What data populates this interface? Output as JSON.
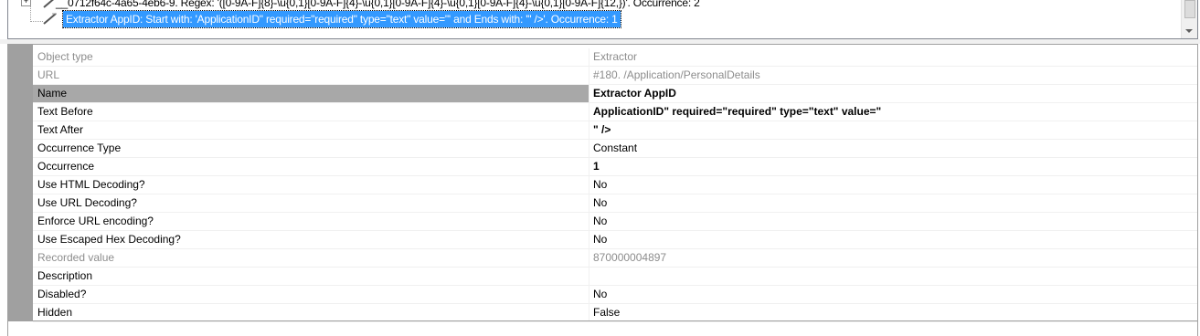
{
  "tree": {
    "items": [
      {
        "label": "__0712f64c-4a65-4eb6-9. Regex: '([0-9A-F]{8}-\\u{0,1}[0-9A-F]{4}-\\u{0,1}[0-9A-F]{4}-\\u{0,1}[0-9A-F]{4}-\\u{0,1}[0-9A-F]{12,})'. Occurrence: 2",
        "icon": "extractor-icon",
        "expander": "+"
      },
      {
        "label": "Extractor AppID: Start with: 'ApplicationID\" required=\"required\" type=\"text\" value=\"' and Ends with: '\" />'. Occurrence: 1",
        "icon": "extractor-icon",
        "selected": true
      }
    ]
  },
  "properties": [
    {
      "name": "Object type",
      "value": "Extractor",
      "readonly": true
    },
    {
      "name": "URL",
      "value": "#180. /Application/PersonalDetails",
      "readonly": true
    },
    {
      "name": "Name",
      "value": "Extractor AppID",
      "selected": true,
      "bold": true
    },
    {
      "name": "Text Before",
      "value": "ApplicationID\" required=\"required\" type=\"text\" value=\"",
      "bold": true
    },
    {
      "name": "Text After",
      "value": "\" />",
      "bold": true
    },
    {
      "name": "Occurrence Type",
      "value": "Constant"
    },
    {
      "name": "Occurrence",
      "value": "1",
      "bold": true
    },
    {
      "name": "Use HTML Decoding?",
      "value": "No"
    },
    {
      "name": "Use URL Decoding?",
      "value": "No"
    },
    {
      "name": "Enforce URL encoding?",
      "value": "No"
    },
    {
      "name": "Use Escaped Hex Decoding?",
      "value": "No"
    },
    {
      "name": "Recorded value",
      "value": "870000004897",
      "readonly": true
    },
    {
      "name": "Description",
      "value": ""
    },
    {
      "name": "Disabled?",
      "value": "No"
    },
    {
      "name": "Hidden",
      "value": "False"
    }
  ],
  "colors": {
    "selection": "#3399ff",
    "grid_margin": "#a0a0a0",
    "selected_row": "#a8a8a8",
    "readonly_text": "#8d8d8d"
  }
}
